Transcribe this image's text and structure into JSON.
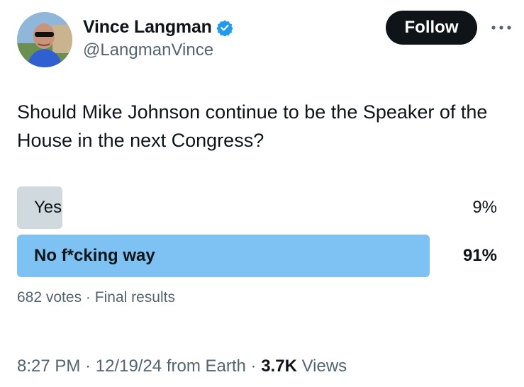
{
  "author": {
    "display_name": "Vince Langman",
    "handle": "@LangmanVince",
    "verified_icon": "verified-badge-icon",
    "avatar_icon": "profile-photo"
  },
  "actions": {
    "follow_label": "Follow",
    "more_icon": "more-options-icon"
  },
  "tweet": {
    "text": "Should Mike Johnson continue to be the Speaker of the House in the next Congress?"
  },
  "poll": {
    "options": [
      {
        "label": "Yes",
        "percent_text": "9%",
        "percent": 9,
        "winner": false
      },
      {
        "label": "No f*cking way",
        "percent_text": "91%",
        "percent": 91,
        "winner": true
      }
    ],
    "votes_text": "682 votes",
    "separator": "·",
    "status_text": "Final results"
  },
  "meta": {
    "time": "8:27 PM",
    "date": "12/19/24",
    "source": "from Earth",
    "views_count": "3.7K",
    "views_label": "Views",
    "separator": "·"
  },
  "colors": {
    "winner_bar": "#7dc2f2",
    "loser_bar": "#cfd9de",
    "verified": "#1d9bf0",
    "follow_bg": "#0f1419"
  }
}
